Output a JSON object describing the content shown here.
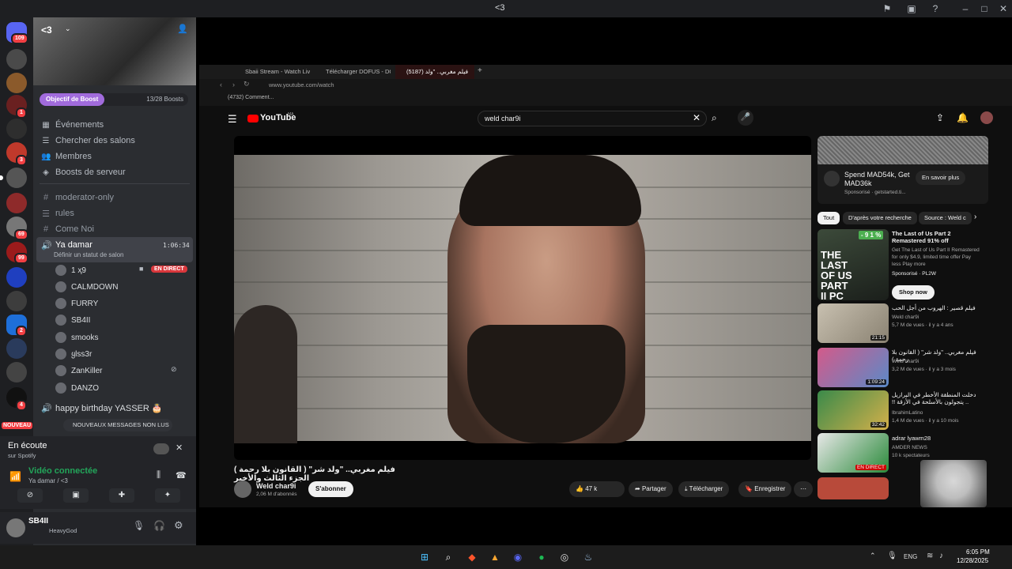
{
  "window": {
    "title": "<3"
  },
  "server_rail": {
    "badges": [
      "109",
      "1",
      "3",
      "69",
      "99",
      "4",
      "4",
      "2"
    ],
    "new_label": "NOUVEAU"
  },
  "server": {
    "name": "<3",
    "boost_goal": "Objectif de Boost",
    "boost_count": "13/28 Boosts",
    "menu": [
      "Événements",
      "Chercher des salons",
      "Membres",
      "Boosts de serveur"
    ],
    "channels": [
      "moderator-only",
      "rules",
      "Come Noi"
    ],
    "voice_channel": {
      "name": "Ya damar",
      "time": "1:06:34",
      "status": "Définir un statut de salon"
    },
    "voice_users": [
      "1 ҳ9",
      "CALMDOWN",
      "FURRY",
      "SB4II",
      "smooks",
      "ყlss3r",
      "ZanKiller",
      "DANZO"
    ],
    "live_label": "EN DIRECT",
    "channel_after": "happy birthday YASSER 🎂",
    "new_messages": "NOUVEAUX MESSAGES NON LUS"
  },
  "listening": {
    "title": "En écoute",
    "sub": "sur Spotify"
  },
  "voice": {
    "status": "Vidéo connectée",
    "channel": "Ya damar / <3"
  },
  "user": {
    "name": "SB4II",
    "status": "HeavyGod"
  },
  "browser": {
    "tabs": [
      "Sbaii Stream - Watch Live",
      "Télécharger DOFUS - DOF",
      "فيلم مغربي.. \"ولد (5187)"
    ],
    "url": "www.youtube.com/watch",
    "bookmark": "(4732) Comment..."
  },
  "youtube": {
    "logo": "YouTube",
    "logo_sup": "MA",
    "search": "weld char9i",
    "video_title": "فيلم مغربي.. \"ولد شر\" ( القانون بلا رحمة ) الجزء الثالث والأخير",
    "channel": "Weld char9i",
    "subscribers": "2,06 M d'abonnés",
    "subscribe": "S'abonner",
    "likes": "47 k",
    "share": "Partager",
    "download": "Télécharger",
    "save": "Enregistrer",
    "ad": {
      "title": "Spend MAD54k, Get MAD36k",
      "sponsor": "Sponsorisé · getstarted.ti...",
      "cta": "En savoir plus"
    },
    "chips": [
      "Tout",
      "D'après votre recherche",
      "Source : Weld c"
    ],
    "promo": {
      "title": "The Last of Us Part 2 Remastered 91% off",
      "desc": "Get The Last of Us Part II Remastered for only $4.9, limited time offer Pay less Play more",
      "sponsor": "Sponsorisé · PL2W",
      "cta": "Shop now",
      "discount": "- 9 1 %",
      "thumb_text": "THE LAST OF US PART II PC"
    },
    "related": [
      {
        "title": "فيلم قصير : الهروب من أجل الحب",
        "channel": "Weld char9i",
        "meta": "5,7 M de vues · il y a 4 ans",
        "dur": "21:15"
      },
      {
        "title": "فيلم مغربي.. \"ولد شر\" ( القانون بلا رحمة )",
        "channel": "Weld char9i",
        "meta": "3,2 M de vues · il y a 3 mois",
        "dur": "1:09:24"
      },
      {
        "title": "دخلت المنطقة الأخطر في البرازيل .. يتجولون بالأسلحة في الأزقة !!",
        "channel": "IbrahimLatino",
        "meta": "1,4 M de vues · il y a 10 mois",
        "dur": "32:42"
      },
      {
        "title": "adrar lyawm28",
        "channel": "AMDER NEWS",
        "meta": "10 k spectateurs",
        "dur": "EN DIRECT"
      }
    ]
  },
  "taskbar": {
    "lang": "ENG",
    "time": "6:05 PM",
    "date": "12/28/2025"
  }
}
